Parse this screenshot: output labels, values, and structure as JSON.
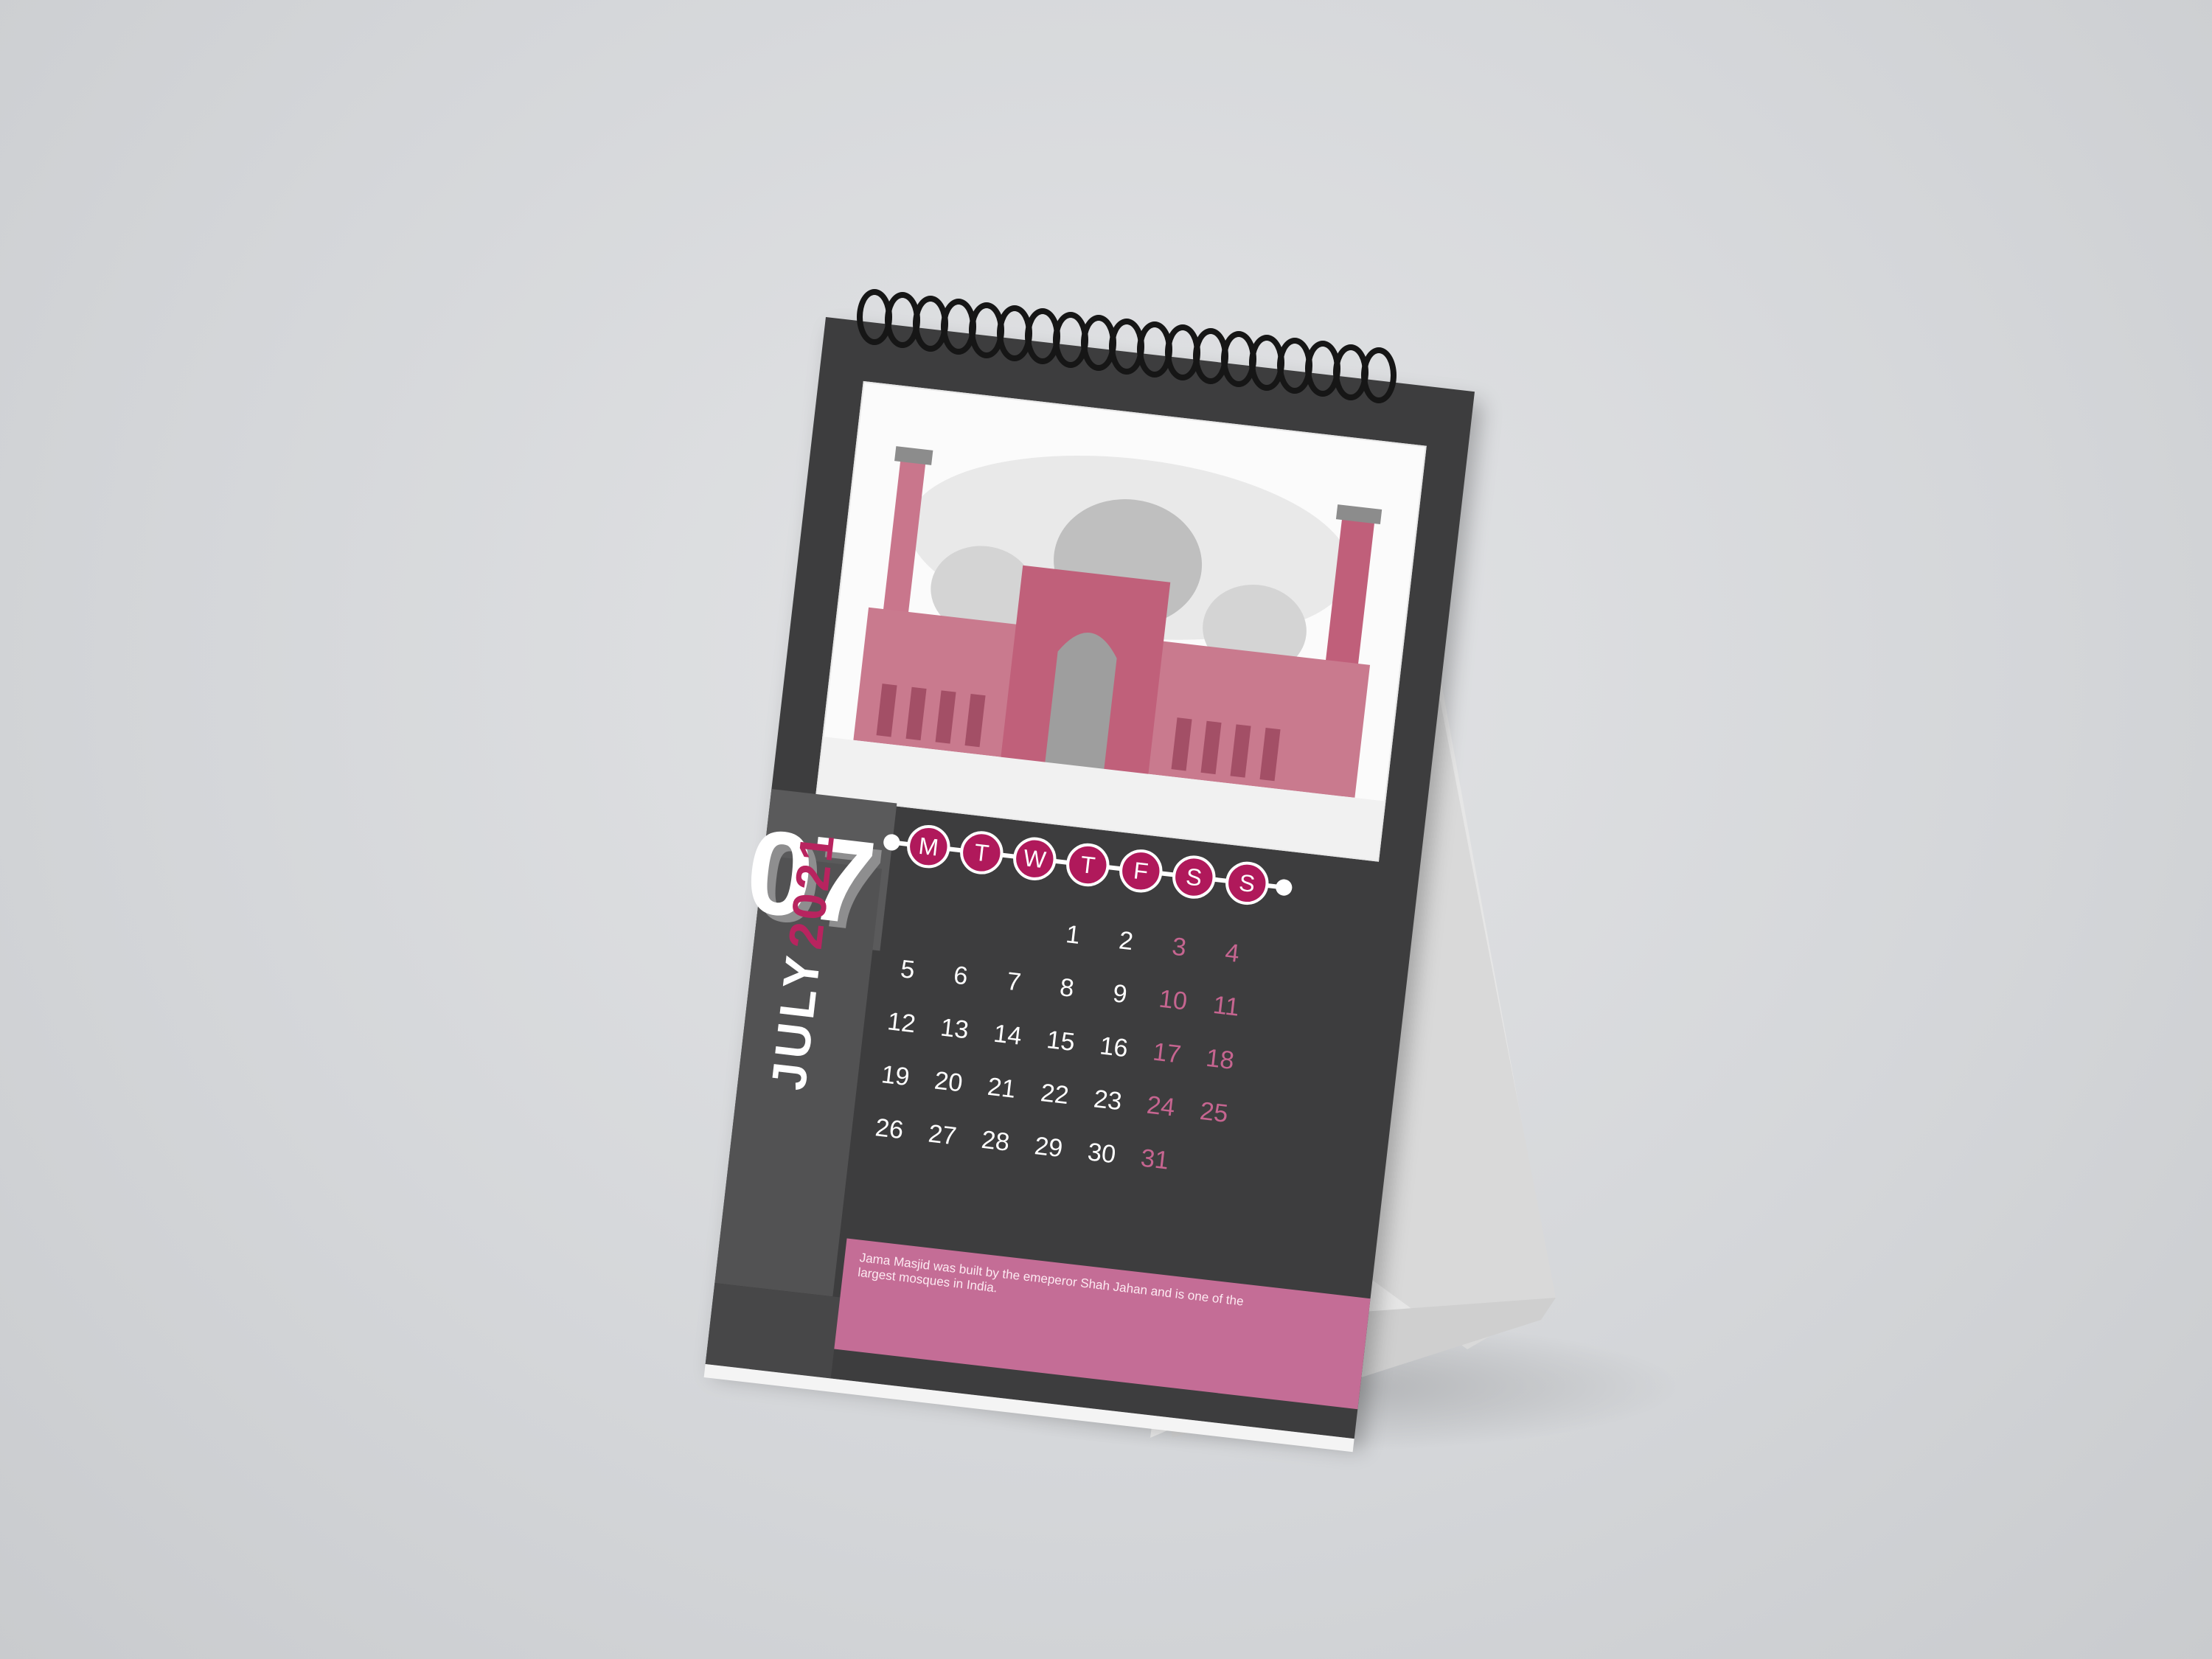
{
  "calendar": {
    "month_number": "07",
    "month_name": "JULY",
    "year": "2021",
    "weekdays": [
      "M",
      "T",
      "W",
      "T",
      "F",
      "S",
      "S"
    ],
    "weeks": [
      [
        "",
        "",
        "",
        "1",
        "2",
        "3",
        "4"
      ],
      [
        "5",
        "6",
        "7",
        "8",
        "9",
        "10",
        "11"
      ],
      [
        "12",
        "13",
        "14",
        "15",
        "16",
        "17",
        "18"
      ],
      [
        "19",
        "20",
        "21",
        "22",
        "23",
        "24",
        "25"
      ],
      [
        "26",
        "27",
        "28",
        "29",
        "30",
        "31",
        ""
      ]
    ],
    "caption": "Jama Masjid was built by the emeperor Shah Jahan and is one of the largest mosques in India.",
    "colors": {
      "accent": "#b0195b",
      "weekend": "#c66590",
      "panel": "#3d3d3e",
      "caption_bar": "#c46d96"
    }
  }
}
